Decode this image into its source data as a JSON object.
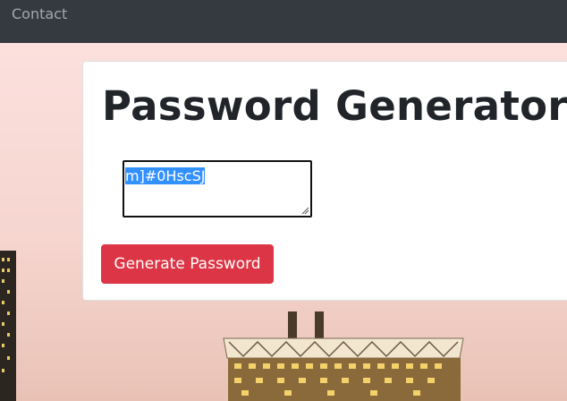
{
  "navbar": {
    "links": [
      {
        "label": "Contact"
      }
    ]
  },
  "card": {
    "title": "Password Generator",
    "password_output": {
      "value": "m]#0HscSJ",
      "selected": true
    },
    "generate_button_label": "Generate Password"
  },
  "colors": {
    "navbar": "#343a40",
    "button": "#dc3545",
    "selection": "#3390ff",
    "title_text": "#212529"
  }
}
